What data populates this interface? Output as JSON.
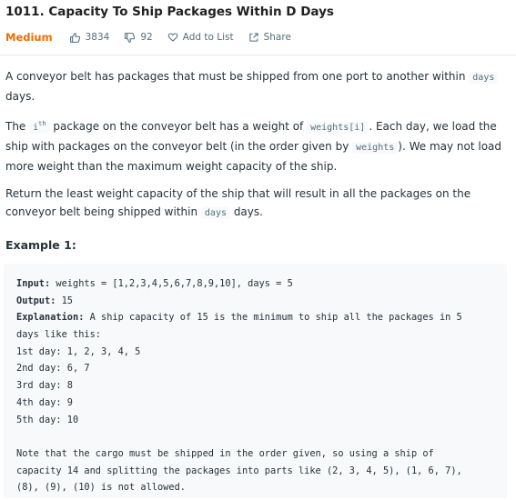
{
  "problem": {
    "title": "1011. Capacity To Ship Packages Within D Days",
    "difficulty": "Medium",
    "likes": "3834",
    "dislikes": "92",
    "add_to_list": "Add to List",
    "share": "Share"
  },
  "description": {
    "p1": [
      "A conveyor belt has packages that must be shipped from one port to another within ",
      "days",
      " days."
    ],
    "p2": [
      "The ",
      "i",
      "th",
      " package on the conveyor belt has a weight of ",
      "weights[i]",
      ". Each day, we load the ship with packages on the conveyor belt (in the order given by ",
      "weights",
      "). We may not load more weight than the maximum weight capacity of the ship."
    ],
    "p3": [
      "Return the least weight capacity of the ship that will result in all the packages on the conveyor belt being shipped within ",
      "days",
      " days."
    ]
  },
  "example": {
    "title": "Example 1:",
    "input_label": "Input:",
    "input_value": " weights = [1,2,3,4,5,6,7,8,9,10], days = 5",
    "output_label": "Output:",
    "output_value": " 15",
    "explanation_label": "Explanation:",
    "explanation_value": " A ship capacity of 15 is the minimum to ship all the packages in 5",
    "lines": [
      "days like this:",
      "1st day: 1, 2, 3, 4, 5",
      "2nd day: 6, 7",
      "3rd day: 8",
      "4th day: 9",
      "5th day: 10",
      "",
      "Note that the cargo must be shipped in the order given, so using a ship of",
      "capacity 14 and splitting the packages into parts like (2, 3, 4, 5), (1, 6, 7),",
      "(8), (9), (10) is not allowed."
    ]
  },
  "colors": {
    "difficulty_medium": "#ef6c00",
    "code_bg": "#f7f9fa",
    "meta_text": "#546e7a"
  },
  "icons": {
    "like": "thumbs-up-icon",
    "dislike": "thumbs-down-icon",
    "add_to_list": "heart-icon",
    "share": "share-icon"
  }
}
